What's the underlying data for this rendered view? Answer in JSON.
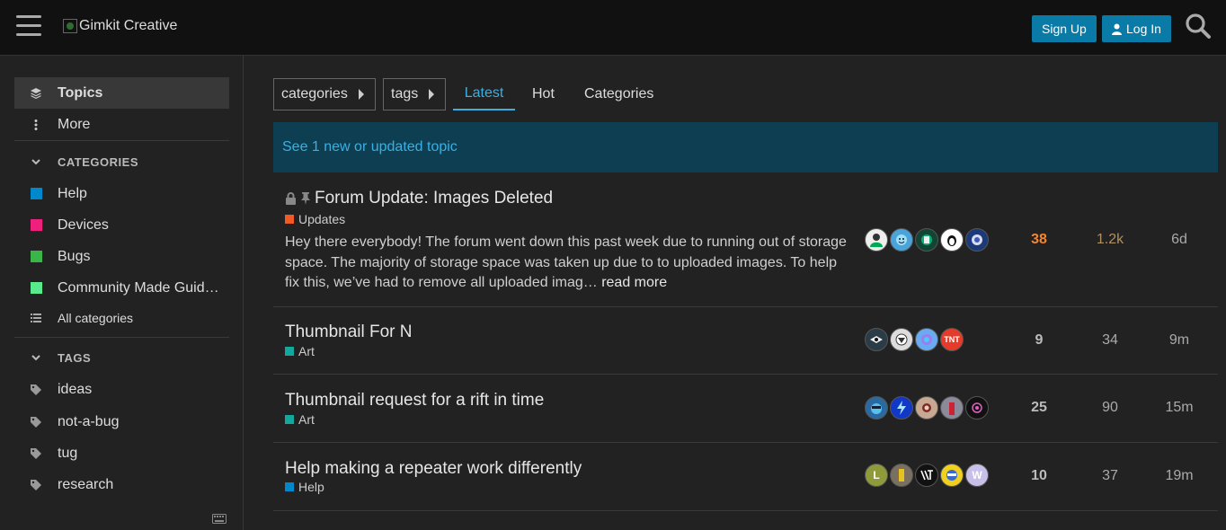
{
  "header": {
    "logo_alt": "Gimkit Creative",
    "signup_label": "Sign Up",
    "login_label": "Log In"
  },
  "sidebar": {
    "topics_label": "Topics",
    "more_label": "More",
    "categories_heading": "CATEGORIES",
    "categories": [
      {
        "label": "Help",
        "color": "#0088cc"
      },
      {
        "label": "Devices",
        "color": "#ed207b"
      },
      {
        "label": "Bugs",
        "color": "#3ab54a"
      },
      {
        "label": "Community Made Guid…",
        "color": "#5aea8e"
      }
    ],
    "all_categories_label": "All categories",
    "tags_heading": "TAGS",
    "tags": [
      "ideas",
      "not-a-bug",
      "tug",
      "research"
    ]
  },
  "nav": {
    "categories_drop": "categories",
    "tags_drop": "tags",
    "tabs": [
      "Latest",
      "Hot",
      "Categories"
    ]
  },
  "banner": "See 1 new or updated topic",
  "topics": [
    {
      "title": "Forum Update: Images Deleted",
      "category": "Updates",
      "category_color": "#f15a24",
      "excerpt": "Hey there everybody! The forum went down this past week due to running out of storage space. The majority of storage space was taken up due to to uploaded images. To help fix this, we’ve had to remove all uploaded imag…",
      "read_more": "read more",
      "replies": "38",
      "views": "1.2k",
      "activity": "6d"
    },
    {
      "title": "Thumbnail For N",
      "category": "Art",
      "category_color": "#12a89d",
      "replies": "9",
      "views": "34",
      "activity": "9m"
    },
    {
      "title": "Thumbnail request for a rift in time",
      "category": "Art",
      "category_color": "#12a89d",
      "replies": "25",
      "views": "90",
      "activity": "15m"
    },
    {
      "title": "Help making a repeater work differently",
      "category": "Help",
      "category_color": "#0088cc",
      "replies": "10",
      "views": "37",
      "activity": "19m",
      "avatar_letters": [
        "L",
        "W"
      ]
    }
  ]
}
